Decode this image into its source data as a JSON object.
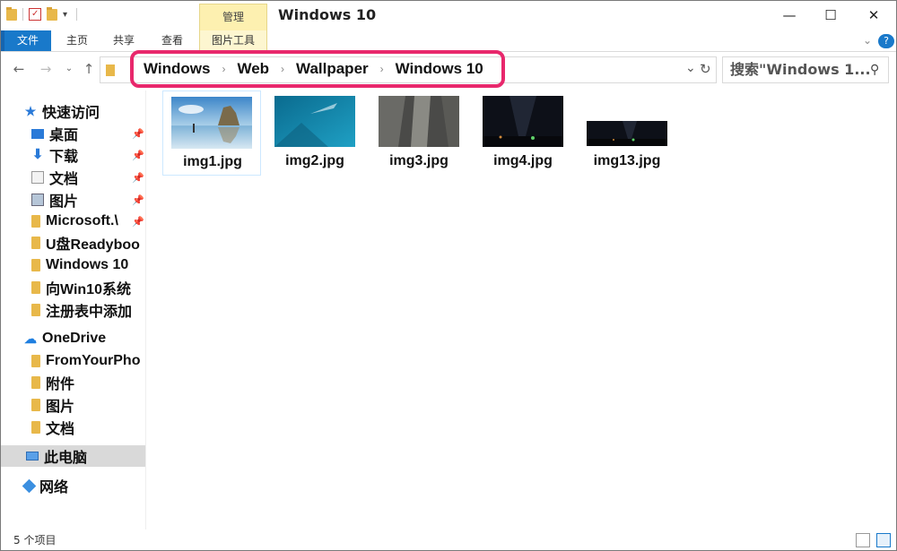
{
  "window": {
    "title": "Windows 10"
  },
  "titlebar": {
    "context_tab": "管理",
    "minimize": "—",
    "maximize": "☐",
    "close": "✕"
  },
  "ribbon": {
    "tabs": [
      "文件",
      "主页",
      "共享",
      "查看",
      "图片工具"
    ],
    "expand_icon": "⌄",
    "help_icon": "?"
  },
  "address": {
    "breadcrumbs": [
      "Windows",
      "Web",
      "Wallpaper",
      "Windows 10"
    ],
    "search_placeholder": "搜索\"Windows 1...",
    "refresh_icon": "↻"
  },
  "sidebar": {
    "quick_access": "快速访问",
    "items": [
      {
        "label": "桌面",
        "icon": "desktop-icon",
        "pinned": true
      },
      {
        "label": "下载",
        "icon": "download-icon",
        "pinned": true
      },
      {
        "label": "文档",
        "icon": "document-icon",
        "pinned": true
      },
      {
        "label": "图片",
        "icon": "pictures-icon",
        "pinned": true
      },
      {
        "label": "Microsoft.\\",
        "icon": "folder-icon",
        "pinned": true
      },
      {
        "label": "U盘Readyboo",
        "icon": "folder-icon",
        "pinned": false
      },
      {
        "label": "Windows 10",
        "icon": "folder-icon",
        "pinned": false
      },
      {
        "label": "向Win10系统",
        "icon": "folder-icon",
        "pinned": false
      },
      {
        "label": "注册表中添加",
        "icon": "folder-icon",
        "pinned": false
      }
    ],
    "onedrive": "OneDrive",
    "onedrive_items": [
      "FromYourPho",
      "附件",
      "图片",
      "文档"
    ],
    "this_pc": "此电脑",
    "network": "网络"
  },
  "files": [
    {
      "name": "img1.jpg",
      "selected": true
    },
    {
      "name": "img2.jpg",
      "selected": false
    },
    {
      "name": "img3.jpg",
      "selected": false
    },
    {
      "name": "img4.jpg",
      "selected": false
    },
    {
      "name": "img13.jpg",
      "selected": false
    }
  ],
  "status": {
    "count": "5 个项目"
  },
  "colors": {
    "accent": "#1979ca",
    "highlight": "#e8286c",
    "selection": "#cde8ff"
  }
}
